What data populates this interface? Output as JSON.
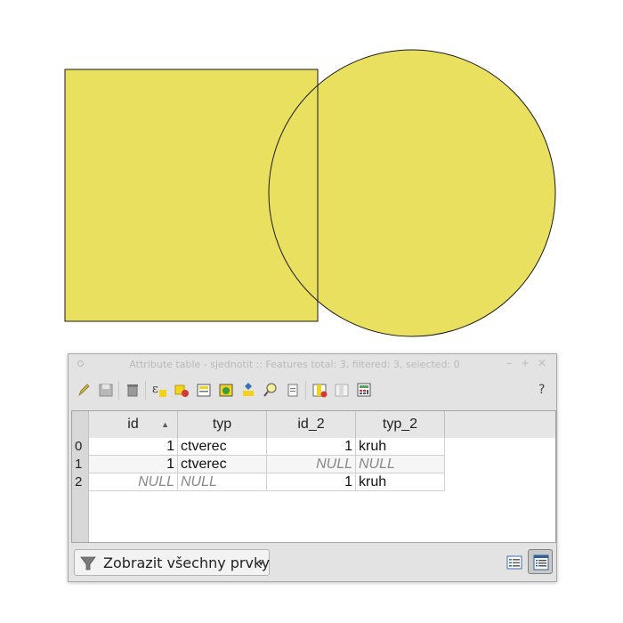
{
  "map": {
    "fill_color": "#EAE05F",
    "stroke_color": "#1a1a1a",
    "features": [
      "square-polygon",
      "circle-polygon"
    ]
  },
  "window": {
    "title": "Attribute table - sjednotit :: Features total: 3, filtered: 3, selected: 0",
    "minimize": "–",
    "maximize": "+",
    "close": "✕"
  },
  "toolbar": {
    "icons": [
      "pencil-icon",
      "save-icon",
      "delete-icon",
      "expression-select-icon",
      "deselect-icon",
      "move-selection-top-icon",
      "invert-selection-icon",
      "pan-to-selection-icon",
      "zoom-to-selection-icon",
      "copy-rows-icon",
      "delete-column-icon",
      "new-column-icon",
      "field-calculator-icon"
    ],
    "help_label": "?"
  },
  "table": {
    "columns": [
      {
        "label": "id",
        "sorted": "ascending"
      },
      {
        "label": "typ"
      },
      {
        "label": "id_2"
      },
      {
        "label": "typ_2"
      }
    ],
    "rows": [
      {
        "row_label": "0",
        "id": "1",
        "typ": "ctverec",
        "id_2": "1",
        "typ_2": "kruh"
      },
      {
        "row_label": "1",
        "id": "1",
        "typ": "ctverec",
        "id_2": "NULL",
        "typ_2": "NULL"
      },
      {
        "row_label": "2",
        "id": "NULL",
        "typ": "NULL",
        "id_2": "1",
        "typ_2": "kruh"
      }
    ],
    "sort_indicator": "▲"
  },
  "bottom": {
    "filter_label": "Zobrazit všechny prvky",
    "filter_arrow": "▾",
    "form_view_icon": "form-view-icon",
    "table_view_icon": "table-view-icon"
  }
}
